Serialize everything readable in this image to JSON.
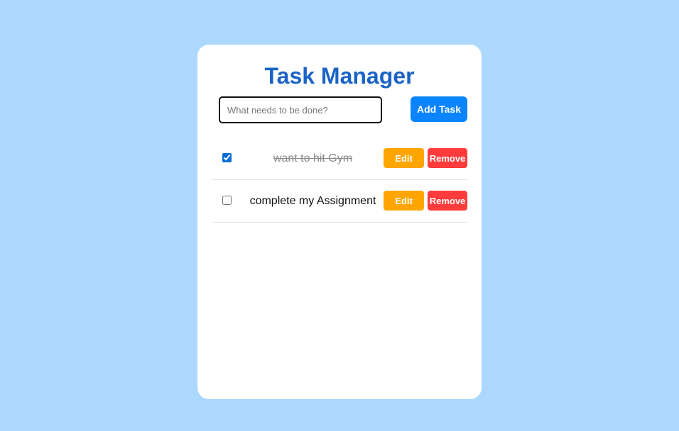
{
  "app": {
    "title": "Task Manager"
  },
  "input": {
    "placeholder": "What needs to be done?",
    "value": ""
  },
  "buttons": {
    "add_label": "Add Task",
    "edit_label": "Edit",
    "remove_label": "Remove"
  },
  "tasks": [
    {
      "text": "want to hit Gym",
      "completed": true
    },
    {
      "text": "complete my Assignment",
      "completed": false
    }
  ],
  "colors": {
    "background": "#add8fd",
    "card": "#ffffff",
    "title": "#1b64c6",
    "add_button": "#0a84ff",
    "edit_button": "#ffa500",
    "remove_button": "#ff3b3b"
  }
}
